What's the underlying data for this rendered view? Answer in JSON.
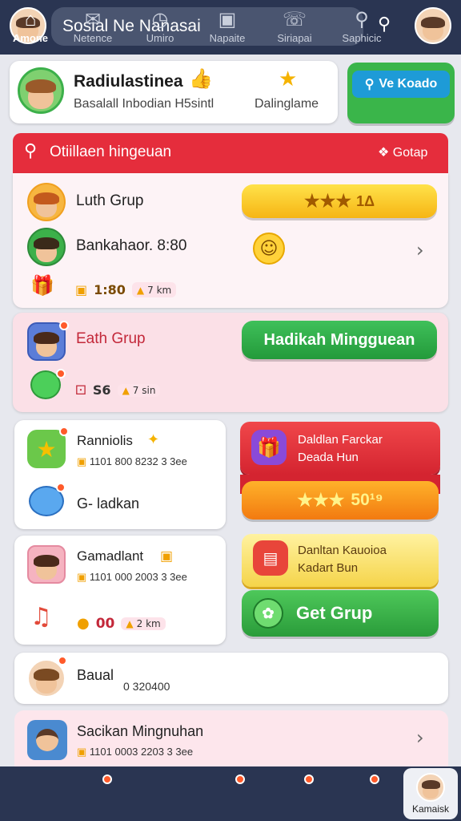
{
  "header": {
    "search_text": "Sosial Ne Nanasai"
  },
  "profile_card": {
    "title": "Radiulastinea",
    "subtitle": "Basalall Inbodian H5sintl",
    "right_text": "Dalinglame"
  },
  "top_button": {
    "label": "Ve Koado"
  },
  "section": {
    "title": "Otiillaen hingeuan",
    "right_label": "Gotap"
  },
  "group1": {
    "name1": "Luth Grup",
    "name2": "Bankahaor. 8:80",
    "stars_text": "1Δ",
    "chip_a": "1:80",
    "chip_b": "7 km"
  },
  "group2": {
    "name": "Eath Grup",
    "button": "Hadikah Mingguean",
    "chip_a": "S6",
    "chip_b": "7 sin"
  },
  "group3": {
    "name1": "Ranniolis",
    "meta1": "1101 800 8232 3 3ee",
    "name2": "G- ladkan"
  },
  "reward1": {
    "line1": "Daldlan Farckar",
    "line2": "Deada Hun",
    "stars_text": "50¹⁹"
  },
  "group4": {
    "name1": "Gamadlant",
    "meta1": "1101 000 2003 3 3ee",
    "chip_a": "00",
    "chip_b": "2 km"
  },
  "reward2": {
    "line1": "Danltan Kauoioa",
    "line2": "Kadart Bun",
    "button": "Get Grup"
  },
  "row5": {
    "name": "Baual",
    "meta": "0 320400"
  },
  "row6": {
    "name": "Sacikan Mingnuhan",
    "meta": "1101 0003 2203 3 3ee"
  },
  "bottom_nav": {
    "items": [
      {
        "label": "Amone"
      },
      {
        "label": "Netence"
      },
      {
        "label": "Umiro"
      },
      {
        "label": "Napaite"
      },
      {
        "label": "Siriapai"
      },
      {
        "label": "Saphicic"
      },
      {
        "label": "Kamaisk"
      }
    ]
  }
}
